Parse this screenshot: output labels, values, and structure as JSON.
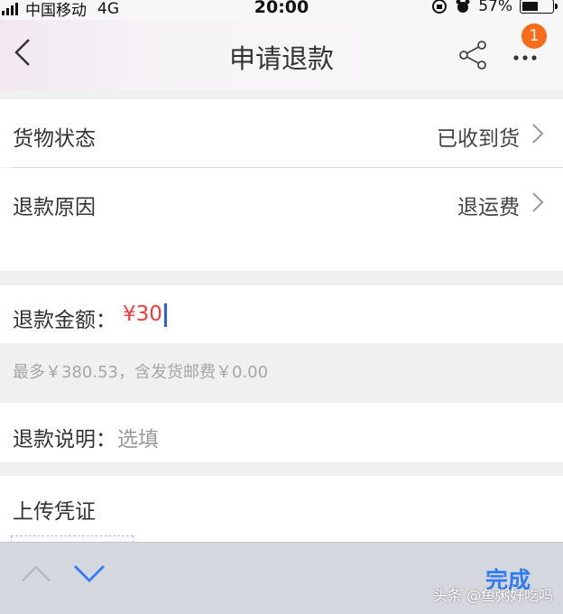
{
  "status_bar": {
    "carrier": "中国移动",
    "network": "4G",
    "time": "20:00",
    "battery_percent": "57%",
    "battery_level": 0.57,
    "icons": [
      "signal-icon",
      "rotation-lock-icon",
      "alarm-icon",
      "battery-icon"
    ]
  },
  "nav": {
    "title": "申请退款",
    "badge_count": "1",
    "icons": [
      "back-icon",
      "share-icon",
      "more-icon"
    ]
  },
  "form": {
    "goods_status": {
      "label": "货物状态",
      "value": "已收到货"
    },
    "refund_reason": {
      "label": "退款原因",
      "value": "退运费"
    },
    "refund_amount": {
      "label": "退款金额：",
      "currency": "¥",
      "value": "30"
    },
    "limit_hint": "最多￥380.53，含发货邮费￥0.00",
    "refund_note": {
      "label": "退款说明：",
      "placeholder": "选填"
    },
    "upload_proof": {
      "label": "上传凭证"
    }
  },
  "keyboard_toolbar": {
    "done_label": "完成",
    "icons": [
      "chevron-up-icon",
      "chevron-down-icon"
    ]
  },
  "watermark": "头条 @鱼粥好吃吗",
  "colors": {
    "accent_blue": "#2f7cf6",
    "amount_red": "#f23b3b",
    "badge_orange": "#fb6b1c",
    "caret_blue": "#2b5fe0"
  }
}
